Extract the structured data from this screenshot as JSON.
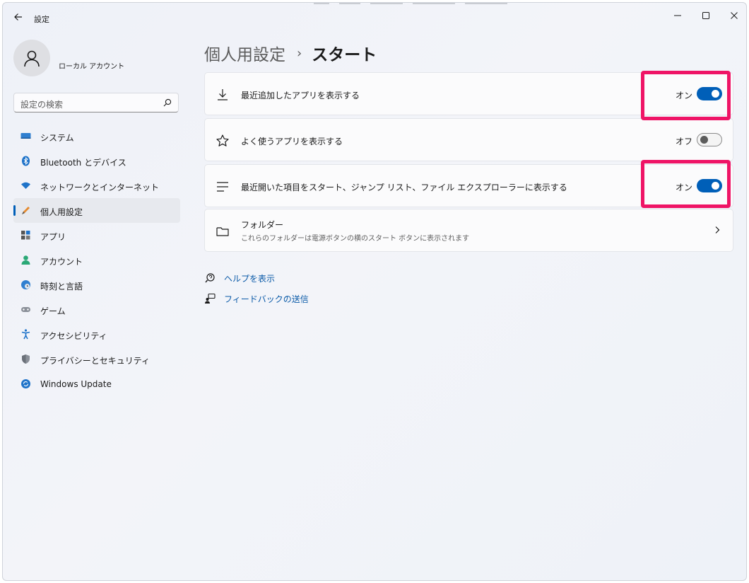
{
  "window": {
    "title": "設定",
    "accent_color": "#005fb8",
    "highlight_color": "#ef1466"
  },
  "account": {
    "name": "ローカル アカウント"
  },
  "search": {
    "placeholder": "設定の検索"
  },
  "sidebar": {
    "items": [
      {
        "label": "システム",
        "icon": "system-icon"
      },
      {
        "label": "Bluetooth とデバイス",
        "icon": "bluetooth-icon"
      },
      {
        "label": "ネットワークとインターネット",
        "icon": "network-icon"
      },
      {
        "label": "個人用設定",
        "icon": "personalization-icon",
        "active": true
      },
      {
        "label": "アプリ",
        "icon": "apps-icon"
      },
      {
        "label": "アカウント",
        "icon": "accounts-icon"
      },
      {
        "label": "時刻と言語",
        "icon": "time-language-icon"
      },
      {
        "label": "ゲーム",
        "icon": "gaming-icon"
      },
      {
        "label": "アクセシビリティ",
        "icon": "accessibility-icon"
      },
      {
        "label": "プライバシーとセキュリティ",
        "icon": "privacy-icon"
      },
      {
        "label": "Windows Update",
        "icon": "windows-update-icon"
      }
    ]
  },
  "breadcrumb": {
    "parent": "個人用設定",
    "separator": "›",
    "current": "スタート"
  },
  "settings": [
    {
      "title": "最近追加したアプリを表示する",
      "state": "オン",
      "on": true,
      "icon": "download-icon"
    },
    {
      "title": "よく使うアプリを表示する",
      "state": "オフ",
      "on": false,
      "icon": "star-icon"
    },
    {
      "title": "最近開いた項目をスタート、ジャンプ リスト、ファイル エクスプローラーに表示する",
      "state": "オン",
      "on": true,
      "icon": "list-icon"
    },
    {
      "title": "フォルダー",
      "description": "これらのフォルダーは電源ボタンの横のスタート ボタンに表示されます",
      "icon": "folder-icon"
    }
  ],
  "links": {
    "help": "ヘルプを表示",
    "feedback": "フィードバックの送信"
  }
}
